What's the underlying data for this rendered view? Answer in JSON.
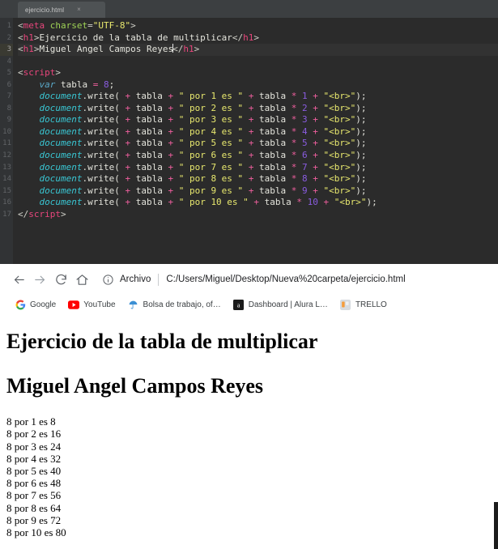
{
  "editor": {
    "tab": {
      "title": "ejercicio.html",
      "close_label": "×"
    },
    "line_numbers": [
      "1",
      "2",
      "3",
      "4",
      "5",
      "6",
      "7",
      "8",
      "9",
      "10",
      "11",
      "12",
      "13",
      "14",
      "15",
      "16",
      "17"
    ],
    "current_line": 3,
    "lines": [
      {
        "n": "1",
        "tokens": [
          {
            "t": "punct",
            "v": "<"
          },
          {
            "t": "tag",
            "v": "meta"
          },
          {
            "t": "plain",
            "v": " "
          },
          {
            "t": "attr",
            "v": "charset"
          },
          {
            "t": "punct",
            "v": "="
          },
          {
            "t": "str",
            "v": "\"UTF-8\""
          },
          {
            "t": "punct",
            "v": ">"
          }
        ]
      },
      {
        "n": "2",
        "tokens": [
          {
            "t": "punct",
            "v": "<"
          },
          {
            "t": "tag",
            "v": "h1"
          },
          {
            "t": "punct",
            "v": ">"
          },
          {
            "t": "txt",
            "v": "Ejercicio de la tabla de multiplicar"
          },
          {
            "t": "punct",
            "v": "</"
          },
          {
            "t": "tag",
            "v": "h1"
          },
          {
            "t": "punct",
            "v": ">"
          }
        ]
      },
      {
        "n": "3",
        "tokens": [
          {
            "t": "punct",
            "v": "<"
          },
          {
            "t": "tag",
            "v": "h1"
          },
          {
            "t": "punct",
            "v": ">"
          },
          {
            "t": "txt",
            "v": "Miguel Angel Campos Reyes"
          },
          {
            "t": "caret",
            "v": ""
          },
          {
            "t": "punct",
            "v": "</"
          },
          {
            "t": "tag",
            "v": "h1"
          },
          {
            "t": "punct",
            "v": ">"
          }
        ]
      },
      {
        "n": "4",
        "tokens": []
      },
      {
        "n": "5",
        "tokens": [
          {
            "t": "punct",
            "v": "<"
          },
          {
            "t": "tag",
            "v": "script"
          },
          {
            "t": "punct",
            "v": ">"
          }
        ]
      },
      {
        "n": "6",
        "tokens": [
          {
            "t": "plain",
            "v": "    "
          },
          {
            "t": "kw",
            "v": "var"
          },
          {
            "t": "plain",
            "v": " tabla "
          },
          {
            "t": "op",
            "v": "="
          },
          {
            "t": "plain",
            "v": " "
          },
          {
            "t": "num",
            "v": "8"
          },
          {
            "t": "plain",
            "v": ";"
          }
        ]
      },
      {
        "n": "7",
        "tokens": [
          {
            "t": "plain",
            "v": "    "
          },
          {
            "t": "obj",
            "v": "document"
          },
          {
            "t": "plain",
            "v": ".write( "
          },
          {
            "t": "op",
            "v": "+"
          },
          {
            "t": "plain",
            "v": " tabla "
          },
          {
            "t": "op",
            "v": "+"
          },
          {
            "t": "plain",
            "v": " "
          },
          {
            "t": "str",
            "v": "\" por 1 es \""
          },
          {
            "t": "plain",
            "v": " "
          },
          {
            "t": "op",
            "v": "+"
          },
          {
            "t": "plain",
            "v": " tabla "
          },
          {
            "t": "op",
            "v": "*"
          },
          {
            "t": "plain",
            "v": " "
          },
          {
            "t": "num",
            "v": "1"
          },
          {
            "t": "plain",
            "v": " "
          },
          {
            "t": "op",
            "v": "+"
          },
          {
            "t": "plain",
            "v": " "
          },
          {
            "t": "str",
            "v": "\"<br>\""
          },
          {
            "t": "plain",
            "v": ");"
          }
        ]
      },
      {
        "n": "8",
        "tokens": [
          {
            "t": "plain",
            "v": "    "
          },
          {
            "t": "obj",
            "v": "document"
          },
          {
            "t": "plain",
            "v": ".write( "
          },
          {
            "t": "op",
            "v": "+"
          },
          {
            "t": "plain",
            "v": " tabla "
          },
          {
            "t": "op",
            "v": "+"
          },
          {
            "t": "plain",
            "v": " "
          },
          {
            "t": "str",
            "v": "\" por 2 es \""
          },
          {
            "t": "plain",
            "v": " "
          },
          {
            "t": "op",
            "v": "+"
          },
          {
            "t": "plain",
            "v": " tabla "
          },
          {
            "t": "op",
            "v": "*"
          },
          {
            "t": "plain",
            "v": " "
          },
          {
            "t": "num",
            "v": "2"
          },
          {
            "t": "plain",
            "v": " "
          },
          {
            "t": "op",
            "v": "+"
          },
          {
            "t": "plain",
            "v": " "
          },
          {
            "t": "str",
            "v": "\"<br>\""
          },
          {
            "t": "plain",
            "v": ");"
          }
        ]
      },
      {
        "n": "9",
        "tokens": [
          {
            "t": "plain",
            "v": "    "
          },
          {
            "t": "obj",
            "v": "document"
          },
          {
            "t": "plain",
            "v": ".write( "
          },
          {
            "t": "op",
            "v": "+"
          },
          {
            "t": "plain",
            "v": " tabla "
          },
          {
            "t": "op",
            "v": "+"
          },
          {
            "t": "plain",
            "v": " "
          },
          {
            "t": "str",
            "v": "\" por 3 es \""
          },
          {
            "t": "plain",
            "v": " "
          },
          {
            "t": "op",
            "v": "+"
          },
          {
            "t": "plain",
            "v": " tabla "
          },
          {
            "t": "op",
            "v": "*"
          },
          {
            "t": "plain",
            "v": " "
          },
          {
            "t": "num",
            "v": "3"
          },
          {
            "t": "plain",
            "v": " "
          },
          {
            "t": "op",
            "v": "+"
          },
          {
            "t": "plain",
            "v": " "
          },
          {
            "t": "str",
            "v": "\"<br>\""
          },
          {
            "t": "plain",
            "v": ");"
          }
        ]
      },
      {
        "n": "10",
        "tokens": [
          {
            "t": "plain",
            "v": "    "
          },
          {
            "t": "obj",
            "v": "document"
          },
          {
            "t": "plain",
            "v": ".write( "
          },
          {
            "t": "op",
            "v": "+"
          },
          {
            "t": "plain",
            "v": " tabla "
          },
          {
            "t": "op",
            "v": "+"
          },
          {
            "t": "plain",
            "v": " "
          },
          {
            "t": "str",
            "v": "\" por 4 es \""
          },
          {
            "t": "plain",
            "v": " "
          },
          {
            "t": "op",
            "v": "+"
          },
          {
            "t": "plain",
            "v": " tabla "
          },
          {
            "t": "op",
            "v": "*"
          },
          {
            "t": "plain",
            "v": " "
          },
          {
            "t": "num",
            "v": "4"
          },
          {
            "t": "plain",
            "v": " "
          },
          {
            "t": "op",
            "v": "+"
          },
          {
            "t": "plain",
            "v": " "
          },
          {
            "t": "str",
            "v": "\"<br>\""
          },
          {
            "t": "plain",
            "v": ");"
          }
        ]
      },
      {
        "n": "11",
        "tokens": [
          {
            "t": "plain",
            "v": "    "
          },
          {
            "t": "obj",
            "v": "document"
          },
          {
            "t": "plain",
            "v": ".write( "
          },
          {
            "t": "op",
            "v": "+"
          },
          {
            "t": "plain",
            "v": " tabla "
          },
          {
            "t": "op",
            "v": "+"
          },
          {
            "t": "plain",
            "v": " "
          },
          {
            "t": "str",
            "v": "\" por 5 es \""
          },
          {
            "t": "plain",
            "v": " "
          },
          {
            "t": "op",
            "v": "+"
          },
          {
            "t": "plain",
            "v": " tabla "
          },
          {
            "t": "op",
            "v": "*"
          },
          {
            "t": "plain",
            "v": " "
          },
          {
            "t": "num",
            "v": "5"
          },
          {
            "t": "plain",
            "v": " "
          },
          {
            "t": "op",
            "v": "+"
          },
          {
            "t": "plain",
            "v": " "
          },
          {
            "t": "str",
            "v": "\"<br>\""
          },
          {
            "t": "plain",
            "v": ");"
          }
        ]
      },
      {
        "n": "12",
        "tokens": [
          {
            "t": "plain",
            "v": "    "
          },
          {
            "t": "obj",
            "v": "document"
          },
          {
            "t": "plain",
            "v": ".write( "
          },
          {
            "t": "op",
            "v": "+"
          },
          {
            "t": "plain",
            "v": " tabla "
          },
          {
            "t": "op",
            "v": "+"
          },
          {
            "t": "plain",
            "v": " "
          },
          {
            "t": "str",
            "v": "\" por 6 es \""
          },
          {
            "t": "plain",
            "v": " "
          },
          {
            "t": "op",
            "v": "+"
          },
          {
            "t": "plain",
            "v": " tabla "
          },
          {
            "t": "op",
            "v": "*"
          },
          {
            "t": "plain",
            "v": " "
          },
          {
            "t": "num",
            "v": "6"
          },
          {
            "t": "plain",
            "v": " "
          },
          {
            "t": "op",
            "v": "+"
          },
          {
            "t": "plain",
            "v": " "
          },
          {
            "t": "str",
            "v": "\"<br>\""
          },
          {
            "t": "plain",
            "v": ");"
          }
        ]
      },
      {
        "n": "13",
        "tokens": [
          {
            "t": "plain",
            "v": "    "
          },
          {
            "t": "obj",
            "v": "document"
          },
          {
            "t": "plain",
            "v": ".write( "
          },
          {
            "t": "op",
            "v": "+"
          },
          {
            "t": "plain",
            "v": " tabla "
          },
          {
            "t": "op",
            "v": "+"
          },
          {
            "t": "plain",
            "v": " "
          },
          {
            "t": "str",
            "v": "\" por 7 es \""
          },
          {
            "t": "plain",
            "v": " "
          },
          {
            "t": "op",
            "v": "+"
          },
          {
            "t": "plain",
            "v": " tabla "
          },
          {
            "t": "op",
            "v": "*"
          },
          {
            "t": "plain",
            "v": " "
          },
          {
            "t": "num",
            "v": "7"
          },
          {
            "t": "plain",
            "v": " "
          },
          {
            "t": "op",
            "v": "+"
          },
          {
            "t": "plain",
            "v": " "
          },
          {
            "t": "str",
            "v": "\"<br>\""
          },
          {
            "t": "plain",
            "v": ");"
          }
        ]
      },
      {
        "n": "14",
        "tokens": [
          {
            "t": "plain",
            "v": "    "
          },
          {
            "t": "obj",
            "v": "document"
          },
          {
            "t": "plain",
            "v": ".write( "
          },
          {
            "t": "op",
            "v": "+"
          },
          {
            "t": "plain",
            "v": " tabla "
          },
          {
            "t": "op",
            "v": "+"
          },
          {
            "t": "plain",
            "v": " "
          },
          {
            "t": "str",
            "v": "\" por 8 es \""
          },
          {
            "t": "plain",
            "v": " "
          },
          {
            "t": "op",
            "v": "+"
          },
          {
            "t": "plain",
            "v": " tabla "
          },
          {
            "t": "op",
            "v": "*"
          },
          {
            "t": "plain",
            "v": " "
          },
          {
            "t": "num",
            "v": "8"
          },
          {
            "t": "plain",
            "v": " "
          },
          {
            "t": "op",
            "v": "+"
          },
          {
            "t": "plain",
            "v": " "
          },
          {
            "t": "str",
            "v": "\"<br>\""
          },
          {
            "t": "plain",
            "v": ");"
          }
        ]
      },
      {
        "n": "15",
        "tokens": [
          {
            "t": "plain",
            "v": "    "
          },
          {
            "t": "obj",
            "v": "document"
          },
          {
            "t": "plain",
            "v": ".write( "
          },
          {
            "t": "op",
            "v": "+"
          },
          {
            "t": "plain",
            "v": " tabla "
          },
          {
            "t": "op",
            "v": "+"
          },
          {
            "t": "plain",
            "v": " "
          },
          {
            "t": "str",
            "v": "\" por 9 es \""
          },
          {
            "t": "plain",
            "v": " "
          },
          {
            "t": "op",
            "v": "+"
          },
          {
            "t": "plain",
            "v": " tabla "
          },
          {
            "t": "op",
            "v": "*"
          },
          {
            "t": "plain",
            "v": " "
          },
          {
            "t": "num",
            "v": "9"
          },
          {
            "t": "plain",
            "v": " "
          },
          {
            "t": "op",
            "v": "+"
          },
          {
            "t": "plain",
            "v": " "
          },
          {
            "t": "str",
            "v": "\"<br>\""
          },
          {
            "t": "plain",
            "v": ");"
          }
        ]
      },
      {
        "n": "16",
        "tokens": [
          {
            "t": "plain",
            "v": "    "
          },
          {
            "t": "obj",
            "v": "document"
          },
          {
            "t": "plain",
            "v": ".write( "
          },
          {
            "t": "op",
            "v": "+"
          },
          {
            "t": "plain",
            "v": " tabla "
          },
          {
            "t": "op",
            "v": "+"
          },
          {
            "t": "plain",
            "v": " "
          },
          {
            "t": "str",
            "v": "\" por 10 es \""
          },
          {
            "t": "plain",
            "v": " "
          },
          {
            "t": "op",
            "v": "+"
          },
          {
            "t": "plain",
            "v": " tabla "
          },
          {
            "t": "op",
            "v": "*"
          },
          {
            "t": "plain",
            "v": " "
          },
          {
            "t": "num",
            "v": "10"
          },
          {
            "t": "plain",
            "v": " "
          },
          {
            "t": "op",
            "v": "+"
          },
          {
            "t": "plain",
            "v": " "
          },
          {
            "t": "str",
            "v": "\"<br>\""
          },
          {
            "t": "plain",
            "v": ");"
          }
        ]
      },
      {
        "n": "17",
        "tokens": [
          {
            "t": "punct",
            "v": "</"
          },
          {
            "t": "tag",
            "v": "script"
          },
          {
            "t": "punct",
            "v": ">"
          }
        ]
      }
    ]
  },
  "browser": {
    "nav": {
      "back_label": "←",
      "forward_label": "→",
      "reload_label": "C",
      "home_label": "⌂"
    },
    "omnibox": {
      "scheme_label": "Archivo",
      "url": "C:/Users/Miguel/Desktop/Nueva%20carpeta/ejercicio.html"
    },
    "bookmarks": [
      {
        "label": "Google",
        "icon": "google-icon"
      },
      {
        "label": "YouTube",
        "icon": "youtube-icon"
      },
      {
        "label": "Bolsa de trabajo, of…",
        "icon": "umbrella-icon"
      },
      {
        "label": "Dashboard | Alura L…",
        "icon": "alura-icon"
      },
      {
        "label": "TRELLO",
        "icon": "trello-icon"
      }
    ]
  },
  "page_content": {
    "heading1": "Ejercicio de la tabla de multiplicar",
    "heading2": "Miguel Angel Campos Reyes",
    "table_lines": [
      "8 por 1 es 8",
      "8 por 2 es 16",
      "8 por 3 es 24",
      "8 por 4 es 32",
      "8 por 5 es 40",
      "8 por 6 es 48",
      "8 por 7 es 56",
      "8 por 8 es 64",
      "8 por 9 es 72",
      "8 por 10 es 80"
    ]
  },
  "colors": {
    "editor_bg": "#2b2b2b",
    "gutter_bg": "#313335",
    "tabbar_bg": "#3c3f41",
    "tag": "#e8467c",
    "attr": "#9fd356",
    "string": "#e8e86e",
    "keyword": "#5aa8c8",
    "object": "#39c7d4",
    "number": "#8a5ce0",
    "operator": "#ef5f9e",
    "page_bg": "#ffffff",
    "text": "#000000"
  }
}
